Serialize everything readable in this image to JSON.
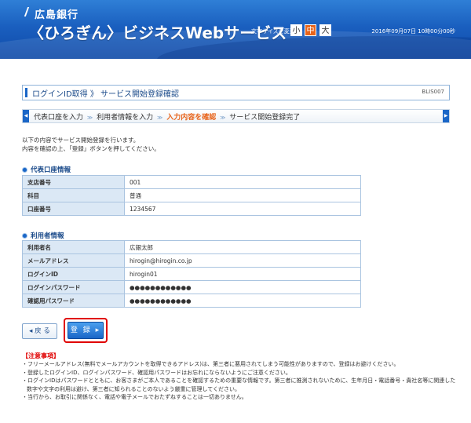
{
  "header": {
    "bank_name": "広島銀行",
    "service_name": "〈ひろぎん〉ビジネスWebサービス",
    "font_size_label": "文字サイズを変更",
    "font_small": "小",
    "font_medium": "中",
    "font_large": "大",
    "datetime": "2016年09月07日 10時00分00秒"
  },
  "title_bar": {
    "title": "ログインID取得 》 サービス開始登録確認",
    "screen_code": "BLIS007"
  },
  "steps": {
    "step1": "代表口座を入力",
    "step2": "利用者情報を入力",
    "step3": "入力内容を確認",
    "step4": "サービス開始登録完了",
    "separator": "≫"
  },
  "intro": {
    "line1": "以下の内容でサービス開始登録を行います。",
    "line2": "内容を確認の上、「登録」ボタンを押してください。"
  },
  "account_section": {
    "heading": "代表口座情報",
    "rows": [
      {
        "label": "支店番号",
        "value": "001"
      },
      {
        "label": "科目",
        "value": "普通"
      },
      {
        "label": "口座番号",
        "value": "1234567"
      }
    ]
  },
  "user_section": {
    "heading": "利用者情報",
    "rows": [
      {
        "label": "利用者名",
        "value": "広銀太郎"
      },
      {
        "label": "メールアドレス",
        "value": "hirogin@hirogin.co.jp"
      },
      {
        "label": "ログインID",
        "value": "hirogin01"
      },
      {
        "label": "ログインパスワード",
        "value": "●●●●●●●●●●●●"
      },
      {
        "label": "確認用パスワード",
        "value": "●●●●●●●●●●●●"
      }
    ]
  },
  "buttons": {
    "back": "◂ 戻 る",
    "register": "登 録 ▸"
  },
  "notes": {
    "title": "【注意事項】",
    "line1": "・フリーメールアドレス(無料でメールアカウントを取得できるアドレス)は、第三者に悪用されてしまう可能性がありますので、登録はお避けください。",
    "line2": "・登録したログインID、ログインパスワード、確認用パスワードはお忘れにならないようにご注意ください。",
    "line3": "・ログインIDはパスワードとともに、お客さまがご本人であることを確認するための重要な情報です。第三者に推測されないために、生年月日・電話番号・貴社名等に関連した",
    "line4": "数字や文字の利用は避け、第三者に知られることのないよう厳重に管理してください。",
    "line5": "・当行から、お取引に関係なく、電話や電子メールでおたずねすることは一切ありません。"
  }
}
